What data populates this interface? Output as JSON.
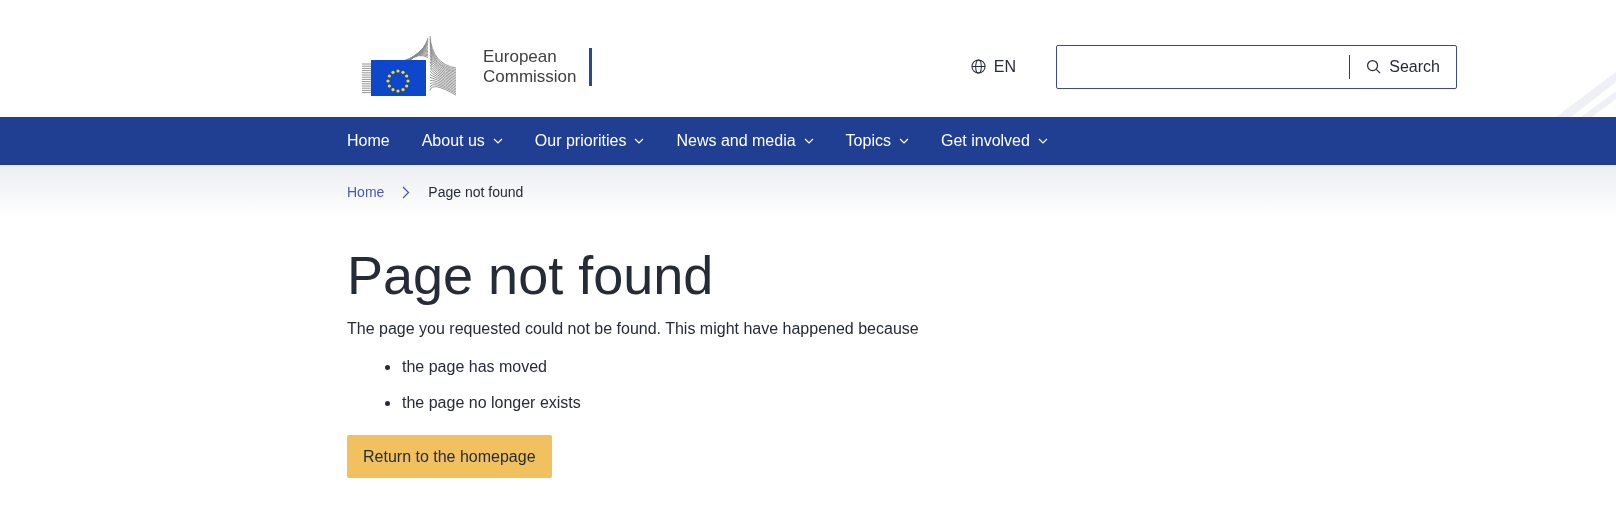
{
  "logo": {
    "lines": [
      "European",
      "Commission"
    ]
  },
  "language": {
    "label": "EN"
  },
  "search": {
    "button": "Search"
  },
  "nav": [
    {
      "label": "Home",
      "has_menu": false
    },
    {
      "label": "About us",
      "has_menu": true
    },
    {
      "label": "Our priorities",
      "has_menu": true
    },
    {
      "label": "News and media",
      "has_menu": true
    },
    {
      "label": "Topics",
      "has_menu": true
    },
    {
      "label": "Get involved",
      "has_menu": true
    }
  ],
  "breadcrumb": [
    {
      "label": "Home",
      "kind": "link"
    },
    {
      "label": "Page not found",
      "kind": "current"
    }
  ],
  "heading": "Page not found",
  "intro": "The page you requested could not be found. This might have happened because",
  "reasons": [
    "the page has moved",
    "the page no longer exists"
  ],
  "button": "Return to the homepage"
}
